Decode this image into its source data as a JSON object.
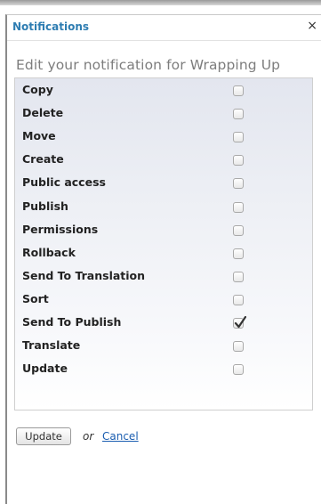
{
  "dialog": {
    "title": "Notifications",
    "close_glyph": "×",
    "heading": "Edit your notification for Wrapping Up"
  },
  "rows": [
    {
      "label": "Copy",
      "checked": false
    },
    {
      "label": "Delete",
      "checked": false
    },
    {
      "label": "Move",
      "checked": false
    },
    {
      "label": "Create",
      "checked": false
    },
    {
      "label": "Public access",
      "checked": false
    },
    {
      "label": "Publish",
      "checked": false
    },
    {
      "label": "Permissions",
      "checked": false
    },
    {
      "label": "Rollback",
      "checked": false
    },
    {
      "label": "Send To Translation",
      "checked": false
    },
    {
      "label": "Sort",
      "checked": false
    },
    {
      "label": "Send To Publish",
      "checked": true
    },
    {
      "label": "Translate",
      "checked": false
    },
    {
      "label": "Update",
      "checked": false
    }
  ],
  "actions": {
    "update_label": "Update",
    "or_text": "or",
    "cancel_label": "Cancel"
  },
  "colors": {
    "title": "#2e7db2",
    "link": "#1a5db0",
    "heading": "#7d7d7d"
  },
  "icons": {
    "close": "close-icon",
    "check": "checkmark-icon"
  }
}
